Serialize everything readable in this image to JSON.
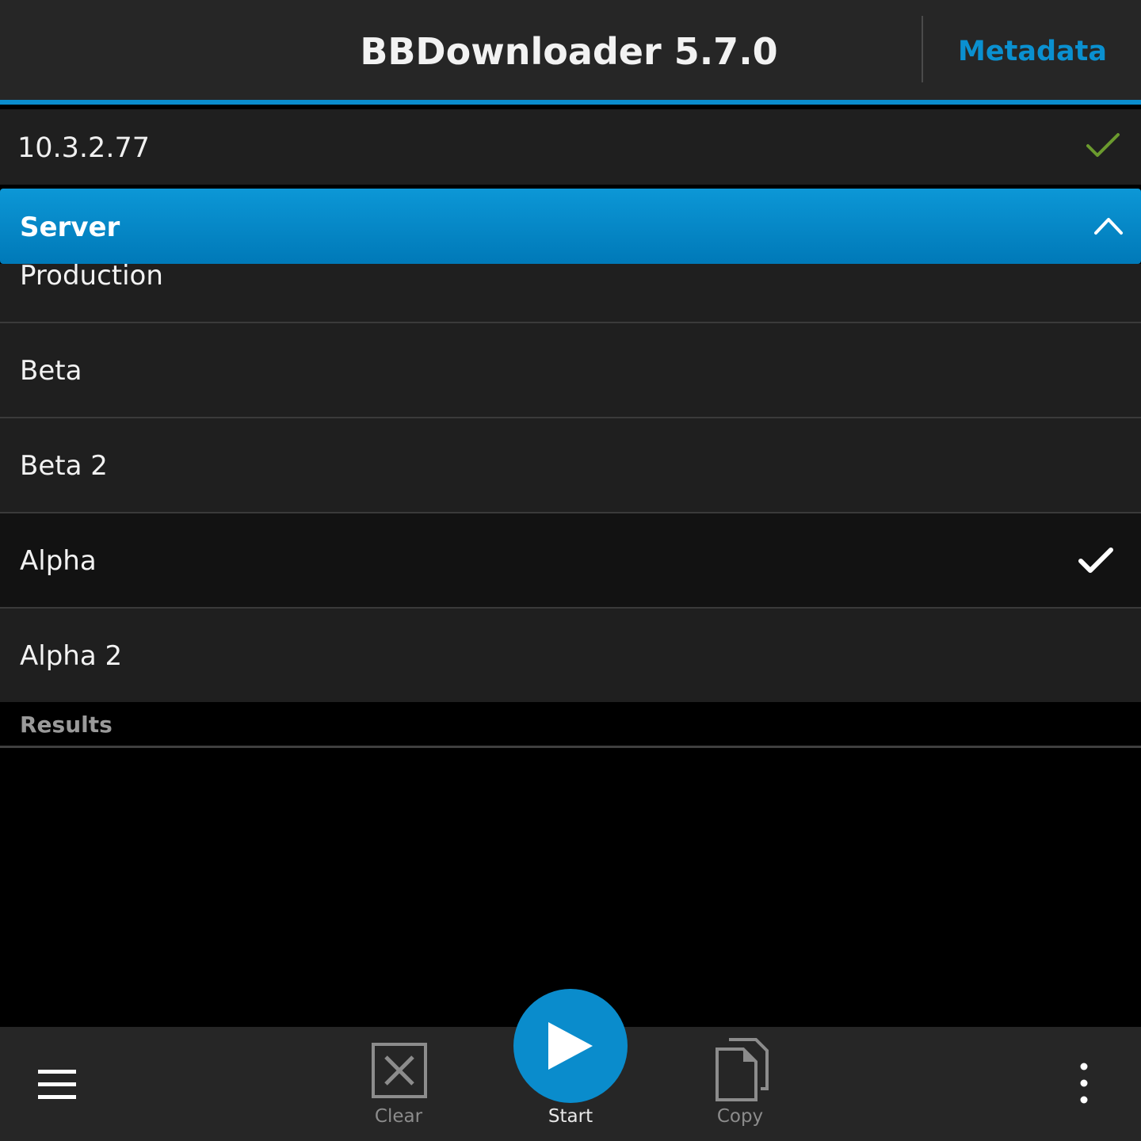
{
  "title_bar": {
    "title": "BBDownloader 5.7.0",
    "metadata_label": "Metadata"
  },
  "version": {
    "value": "10.3.2.77",
    "validated_icon": "check-icon"
  },
  "server_dropdown": {
    "label": "Server",
    "expanded": true,
    "options": [
      {
        "label": "Production",
        "selected": false
      },
      {
        "label": "Beta",
        "selected": false
      },
      {
        "label": "Beta 2",
        "selected": false
      },
      {
        "label": "Alpha",
        "selected": true
      },
      {
        "label": "Alpha 2",
        "selected": false
      }
    ]
  },
  "results": {
    "label": "Results"
  },
  "action_bar": {
    "clear_label": "Clear",
    "start_label": "Start",
    "copy_label": "Copy",
    "menu_icon": "hamburger-icon",
    "overflow_icon": "more-vertical-icon"
  },
  "colors": {
    "accent": "#0a8ccc",
    "metadata_link": "#0a90d0",
    "check_green": "#6b9a2e",
    "background": "#000000",
    "panel": "#1f1f1f",
    "bar": "#262626"
  }
}
